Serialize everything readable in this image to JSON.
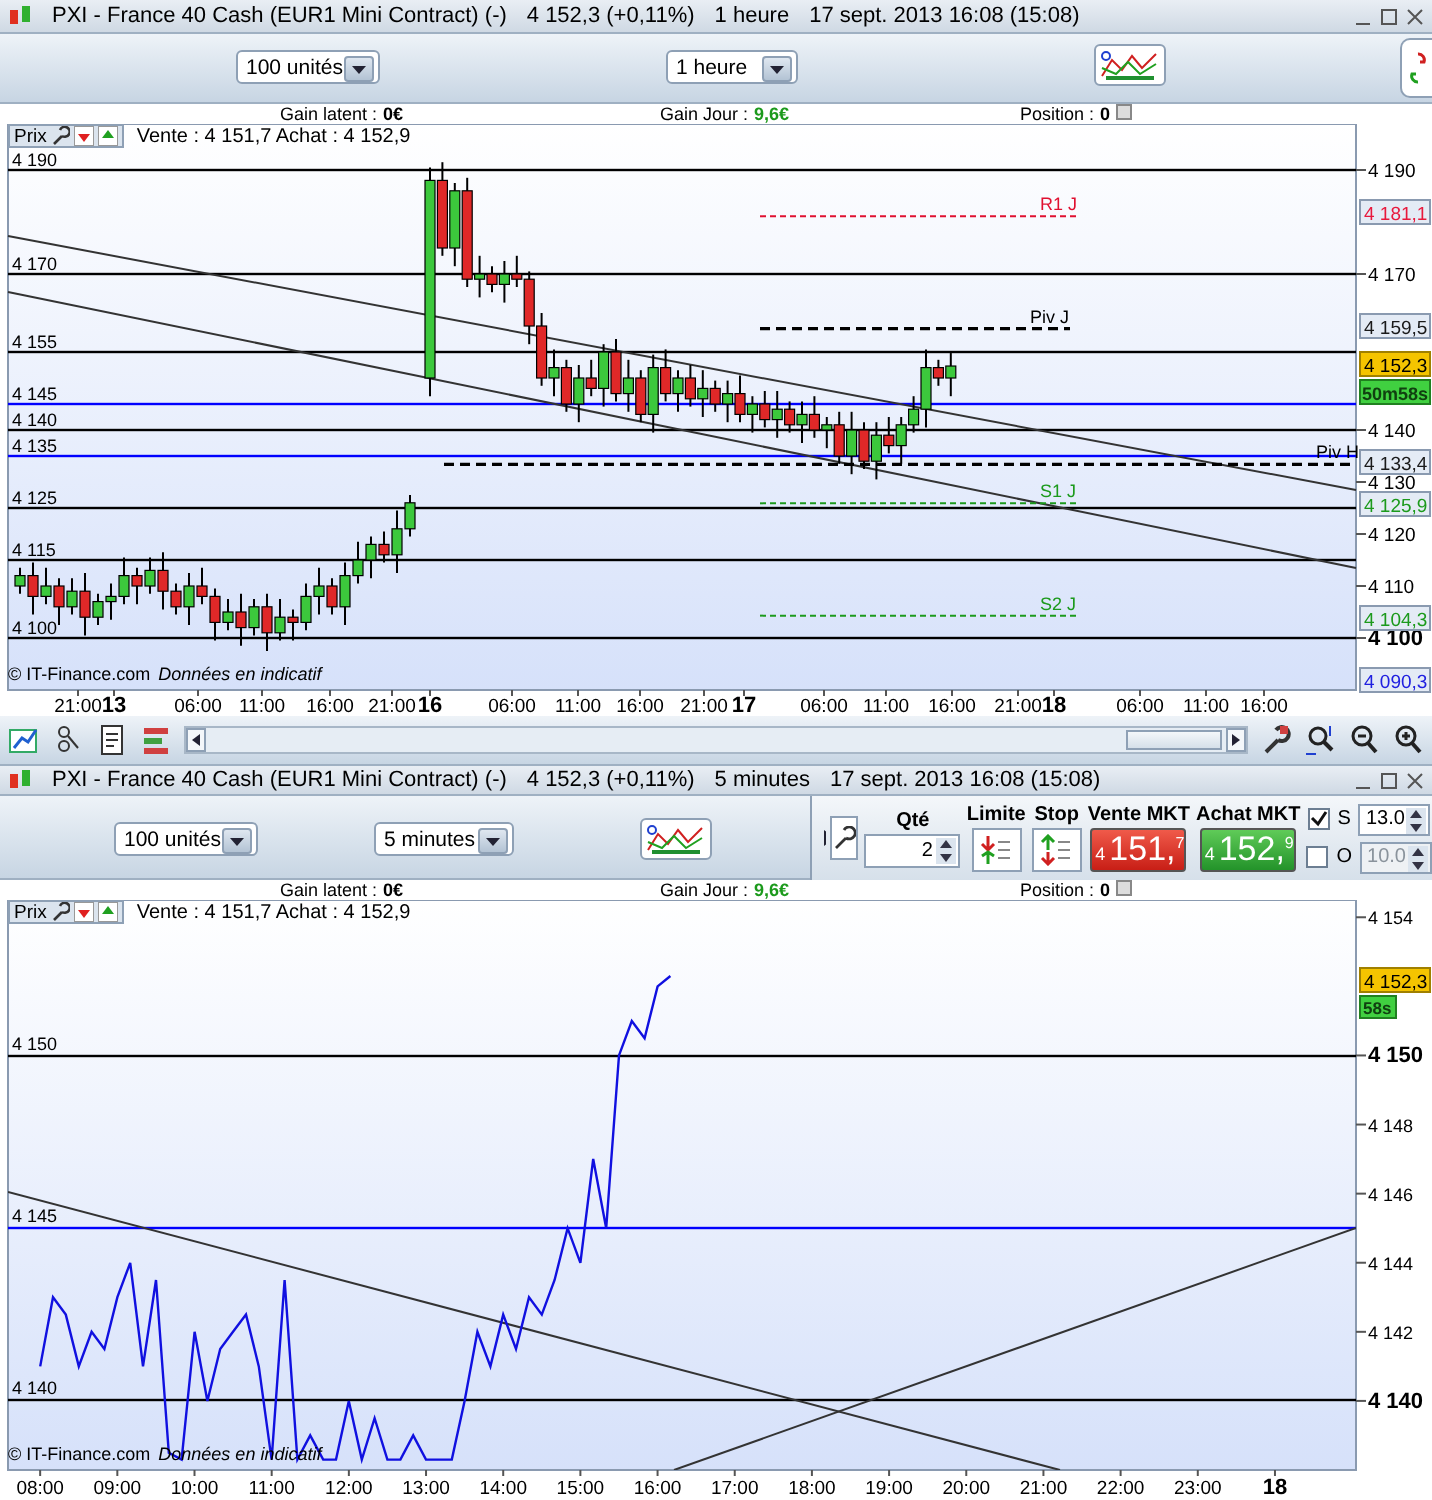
{
  "upper_window": {
    "title": "PXI - France 40 Cash (EUR1 Mini Contract) (-)",
    "quote": "4 152,3 (+0,11%)",
    "period": "1 heure",
    "timestamp": "17 sept. 2013 16:08 (15:08)",
    "quantity_dropdown": "100 unités",
    "period_dropdown": "1 heure",
    "gains": [
      {
        "label": "Gain latent :",
        "value": "0€",
        "color": "#000000"
      },
      {
        "label": "Gain Jour :",
        "value": "9,6€",
        "color": "#1c9a1c"
      },
      {
        "label": "Position :",
        "value": "0",
        "color": "#000000"
      }
    ],
    "price_label": "Prix",
    "sell_buy": "Vente : 4 151,7 Achat : 4 152,9",
    "level_lines": [
      {
        "label": "4 190",
        "color": "#000000"
      },
      {
        "label": "4 170",
        "color": "#000000"
      },
      {
        "label": "4 155",
        "color": "#000000"
      },
      {
        "label": "4 145",
        "color": "#0000ff"
      },
      {
        "label": "4 140",
        "color": "#000000"
      },
      {
        "label": "4 135",
        "color": "#0000ff"
      },
      {
        "label": "4 125",
        "color": "#000000"
      },
      {
        "label": "4 115",
        "color": "#000000"
      },
      {
        "label": "4 100",
        "color": "#000000"
      }
    ],
    "pivots": [
      {
        "label": "R1 J",
        "color": "#e01030"
      },
      {
        "label": "Piv J",
        "color": "#000000"
      },
      {
        "label": "Piv H",
        "color": "#000000"
      },
      {
        "label": "S1 J",
        "color": "#1c9a1c"
      },
      {
        "label": "S2 J",
        "color": "#1c9a1c"
      }
    ],
    "axis_ticks": [
      {
        "label": "4 190",
        "bold": false
      },
      {
        "label": "4 170",
        "bold": false
      },
      {
        "label": "4 140",
        "bold": false
      },
      {
        "label": "4 130",
        "bold": false
      },
      {
        "label": "4 120",
        "bold": false
      },
      {
        "label": "4 110",
        "bold": false
      },
      {
        "label": "4 100",
        "bold": true
      }
    ],
    "price_tags": [
      {
        "label": "4 181,1",
        "color": "#e8183c"
      },
      {
        "label": "4 159,5",
        "color": "#1a1a1a"
      },
      {
        "label": "4 133,4",
        "color": "#1a1a1a"
      },
      {
        "label": "4 125,9",
        "color": "#1c9a1c"
      },
      {
        "label": "4 104,3",
        "color": "#1c9a1c"
      },
      {
        "label": "4 090,3",
        "color": "#2020e0"
      }
    ],
    "current_price": "4 152,3",
    "countdown": "50m58s",
    "credit": "© IT-Finance.com",
    "disclaimer": "Données en indicatif",
    "x_ticks": [
      {
        "label": "21:00",
        "bold": false
      },
      {
        "label": "13",
        "bold": true
      },
      {
        "label": "06:00",
        "bold": false
      },
      {
        "label": "11:00",
        "bold": false
      },
      {
        "label": "16:00",
        "bold": false
      },
      {
        "label": "21:00",
        "bold": false
      },
      {
        "label": "16",
        "bold": true
      },
      {
        "label": "06:00",
        "bold": false
      },
      {
        "label": "11:00",
        "bold": false
      },
      {
        "label": "16:00",
        "bold": false
      },
      {
        "label": "21:00",
        "bold": false
      },
      {
        "label": "17",
        "bold": true
      },
      {
        "label": "06:00",
        "bold": false
      },
      {
        "label": "11:00",
        "bold": false
      },
      {
        "label": "16:00",
        "bold": false
      },
      {
        "label": "21:00",
        "bold": false
      },
      {
        "label": "18",
        "bold": true
      },
      {
        "label": "06:00",
        "bold": false
      },
      {
        "label": "11:00",
        "bold": false
      },
      {
        "label": "16:00",
        "bold": false
      }
    ]
  },
  "lower_window": {
    "title": "PXI - France 40 Cash (EUR1 Mini Contract) (-)",
    "quote": "4 152,3 (+0,11%)",
    "period": "5 minutes",
    "timestamp": "17 sept. 2013 16:08 (15:08)",
    "quantity_dropdown": "100 unités",
    "period_dropdown": "5 minutes",
    "order_panel": {
      "qty_label": "Qté",
      "qty": "2",
      "limit": "Limite",
      "stop": "Stop",
      "sell_label": "Vente MKT",
      "sell_price": {
        "prefix": "4",
        "main": "151,",
        "suffix": "7"
      },
      "buy_label": "Achat MKT",
      "buy_price": {
        "prefix": "4",
        "main": "152,",
        "suffix": "9"
      },
      "stop_loss": {
        "label": "S",
        "checked": true,
        "value": "13.0",
        "disabled": false
      },
      "take_profit": {
        "label": "O",
        "checked": false,
        "value": "10.0",
        "disabled": true
      }
    },
    "gains": [
      {
        "label": "Gain latent :",
        "value": "0€",
        "color": "#000000"
      },
      {
        "label": "Gain Jour :",
        "value": "9,6€",
        "color": "#1c9a1c"
      },
      {
        "label": "Position :",
        "value": "0",
        "color": "#000000"
      }
    ],
    "price_label": "Prix",
    "sell_buy": "Vente : 4 151,7 Achat : 4 152,9",
    "level_lines": [
      {
        "label": "4 150",
        "color": "#000000"
      },
      {
        "label": "4 145",
        "color": "#0000ff"
      },
      {
        "label": "4 140",
        "color": "#000000"
      }
    ],
    "current_price": "4 152,3",
    "countdown": "58s",
    "day_marker": "18",
    "credit": "© IT-Finance.com",
    "disclaimer": "Données en indicatif",
    "chart_data": {
      "type": "line",
      "x": [
        480,
        490,
        500,
        510,
        520,
        530,
        540,
        550,
        560,
        570,
        580,
        590,
        600,
        610,
        620,
        630,
        640,
        650,
        660,
        670,
        680,
        690,
        700,
        710,
        720,
        730,
        740,
        750,
        760,
        770,
        780,
        790,
        800,
        810,
        820,
        830,
        840,
        850,
        860,
        870,
        880,
        890,
        900,
        910,
        920,
        930,
        940,
        950,
        960,
        970
      ],
      "series": [
        {
          "color": "#1010e0",
          "values": [
            4141,
            4143,
            4142.5,
            4141,
            4142,
            4141.5,
            4143,
            4144,
            4141,
            4143.5,
            4138.5,
            4138.3,
            4142,
            4140,
            4141.5,
            4142,
            4142.5,
            4141,
            4138.3,
            4143.5,
            4138.3,
            4139,
            4138.3,
            4138.3,
            4140,
            4138.3,
            4139.5,
            4138.3,
            4138.3,
            4139,
            4138.3,
            4138.3,
            4138.3,
            4140,
            4142,
            4141,
            4142.5,
            4141.5,
            4143,
            4142.5,
            4143.5,
            4145,
            4144,
            4147,
            4145,
            4150,
            4151,
            4150.5,
            4152,
            4152.3
          ]
        }
      ],
      "xlim": [
        455,
        1503
      ],
      "ylim": [
        4138,
        4154.5
      ],
      "xticks": [
        {
          "value": 480,
          "label": "08:00"
        },
        {
          "value": 540,
          "label": "09:00"
        },
        {
          "value": 600,
          "label": "10:00"
        },
        {
          "value": 660,
          "label": "11:00"
        },
        {
          "value": 720,
          "label": "12:00"
        },
        {
          "value": 780,
          "label": "13:00"
        },
        {
          "value": 840,
          "label": "14:00"
        },
        {
          "value": 900,
          "label": "15:00"
        },
        {
          "value": 960,
          "label": "16:00"
        },
        {
          "value": 1020,
          "label": "17:00"
        },
        {
          "value": 1080,
          "label": "18:00"
        },
        {
          "value": 1140,
          "label": "19:00"
        },
        {
          "value": 1200,
          "label": "20:00"
        },
        {
          "value": 1260,
          "label": "21:00"
        },
        {
          "value": 1320,
          "label": "22:00"
        },
        {
          "value": 1380,
          "label": "23:00"
        }
      ],
      "yticks": [
        {
          "value": 4154,
          "label": "4 154"
        },
        {
          "value": 4150,
          "label": "4 150"
        },
        {
          "value": 4148,
          "label": "4 148"
        },
        {
          "value": 4146,
          "label": "4 146"
        },
        {
          "value": 4144,
          "label": "4 144"
        },
        {
          "value": 4142,
          "label": "4 142"
        },
        {
          "value": 4140,
          "label": "4 140"
        }
      ]
    }
  }
}
